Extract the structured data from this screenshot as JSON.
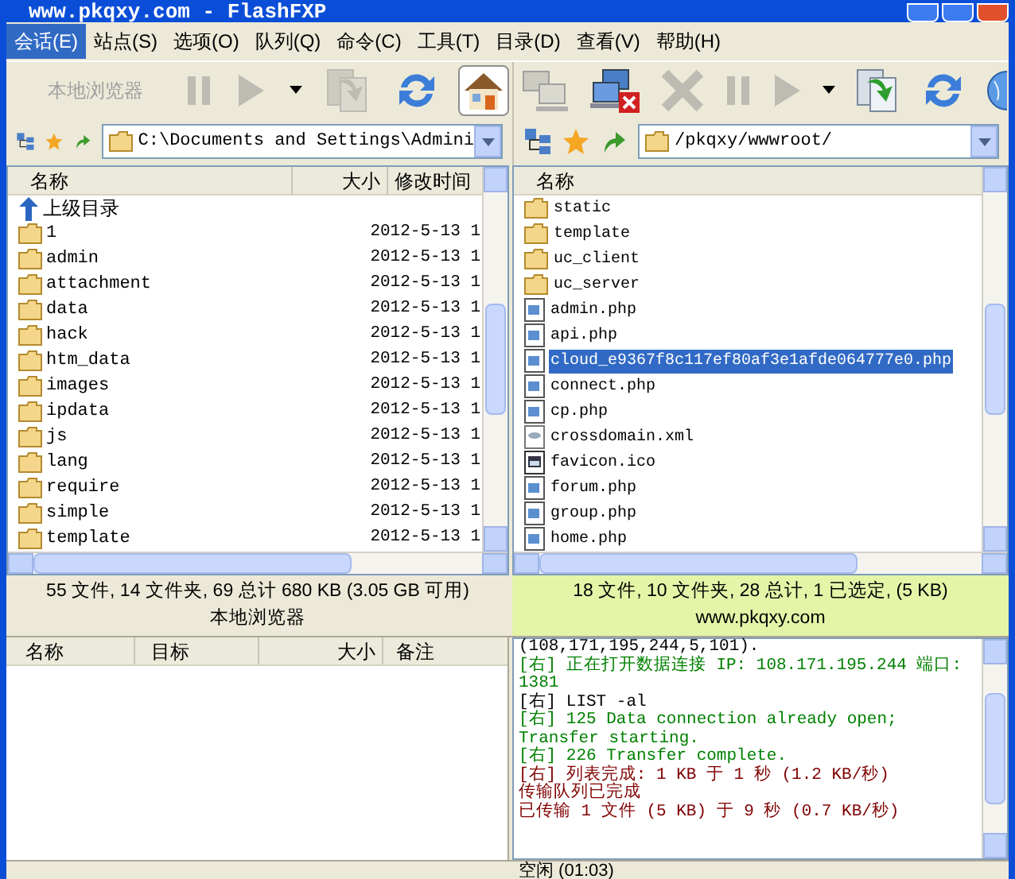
{
  "window": {
    "title": "www.pkqxy.com - FlashFXP"
  },
  "menu": [
    {
      "label": "会话(E)",
      "selected": true
    },
    {
      "label": "站点(S)",
      "selected": false
    },
    {
      "label": "选项(O)",
      "selected": false
    },
    {
      "label": "队列(Q)",
      "selected": false
    },
    {
      "label": "命令(C)",
      "selected": false
    },
    {
      "label": "工具(T)",
      "selected": false
    },
    {
      "label": "目录(D)",
      "selected": false
    },
    {
      "label": "查看(V)",
      "selected": false
    },
    {
      "label": "帮助(H)",
      "selected": false
    }
  ],
  "left_pane": {
    "toolbar_label": "本地浏览器",
    "toolbar": [
      {
        "kind": "pause",
        "disabled": true,
        "pressed": false
      },
      {
        "kind": "play",
        "disabled": true,
        "pressed": false
      },
      {
        "kind": "caret",
        "disabled": false,
        "pressed": false
      },
      {
        "kind": "transfer",
        "disabled": true,
        "pressed": false
      },
      {
        "kind": "refresh",
        "disabled": false,
        "pressed": false
      },
      {
        "kind": "home",
        "disabled": false,
        "pressed": true
      }
    ],
    "path": "C:\\Documents and Settings\\Admini",
    "columns": [
      "名称",
      "大小",
      "修改时间"
    ],
    "rows": [
      {
        "kind": "parent",
        "name": "上级目录"
      },
      {
        "kind": "folder",
        "name": "1",
        "modified": "2012-5-13 1"
      },
      {
        "kind": "folder",
        "name": "admin",
        "modified": "2012-5-13 1"
      },
      {
        "kind": "folder",
        "name": "attachment",
        "modified": "2012-5-13 1"
      },
      {
        "kind": "folder",
        "name": "data",
        "modified": "2012-5-13 1"
      },
      {
        "kind": "folder",
        "name": "hack",
        "modified": "2012-5-13 1"
      },
      {
        "kind": "folder",
        "name": "htm_data",
        "modified": "2012-5-13 1"
      },
      {
        "kind": "folder",
        "name": "images",
        "modified": "2012-5-13 1"
      },
      {
        "kind": "folder",
        "name": "ipdata",
        "modified": "2012-5-13 1"
      },
      {
        "kind": "folder",
        "name": "js",
        "modified": "2012-5-13 1"
      },
      {
        "kind": "folder",
        "name": "lang",
        "modified": "2012-5-13 1"
      },
      {
        "kind": "folder",
        "name": "require",
        "modified": "2012-5-13 1"
      },
      {
        "kind": "folder",
        "name": "simple",
        "modified": "2012-5-13 1"
      },
      {
        "kind": "folder",
        "name": "template",
        "modified": "2012-5-13 1"
      }
    ],
    "status": "55 文件, 14 文件夹, 69 总计 680 KB (3.05 GB 可用)",
    "caption": "本地浏览器"
  },
  "right_pane": {
    "toolbar": [
      {
        "kind": "connect",
        "disabled": true
      },
      {
        "kind": "disconnect",
        "disabled": false
      },
      {
        "kind": "abort",
        "disabled": true
      },
      {
        "kind": "pause",
        "disabled": true
      },
      {
        "kind": "play",
        "disabled": true
      },
      {
        "kind": "caret",
        "disabled": false
      },
      {
        "kind": "transfer",
        "disabled": false
      },
      {
        "kind": "refresh",
        "disabled": false
      },
      {
        "kind": "globe",
        "disabled": false
      }
    ],
    "path": "/pkqxy/wwwroot/",
    "columns": [
      "名称"
    ],
    "rows": [
      {
        "kind": "folder",
        "name": "static",
        "selected": false
      },
      {
        "kind": "folder",
        "name": "template",
        "selected": false
      },
      {
        "kind": "folder",
        "name": "uc_client",
        "selected": false
      },
      {
        "kind": "folder",
        "name": "uc_server",
        "selected": false
      },
      {
        "kind": "script",
        "name": "admin.php",
        "selected": false
      },
      {
        "kind": "script",
        "name": "api.php",
        "selected": false
      },
      {
        "kind": "script",
        "name": "cloud_e9367f8c117ef80af3e1afde064777e0.php",
        "selected": true
      },
      {
        "kind": "script",
        "name": "connect.php",
        "selected": false
      },
      {
        "kind": "script",
        "name": "cp.php",
        "selected": false
      },
      {
        "kind": "xml",
        "name": "crossdomain.xml",
        "selected": false
      },
      {
        "kind": "image",
        "name": "favicon.ico",
        "selected": false
      },
      {
        "kind": "script",
        "name": "forum.php",
        "selected": false
      },
      {
        "kind": "script",
        "name": "group.php",
        "selected": false
      },
      {
        "kind": "script",
        "name": "home.php",
        "selected": false
      }
    ],
    "status": "18 文件, 10 文件夹, 28 总计, 1 已选定, (5 KB)",
    "caption": "www.pkqxy.com"
  },
  "queue": {
    "columns": [
      "名称",
      "目标",
      "大小",
      "备注"
    ]
  },
  "log": [
    {
      "kind": "command",
      "text": "(108,171,195,244,5,101)."
    },
    {
      "kind": "server",
      "text": "[右] 正在打开数据连接 IP: 108.171.195.244 端口: 1381"
    },
    {
      "kind": "command",
      "text": "[右] LIST -al"
    },
    {
      "kind": "server",
      "text": "[右] 125 Data connection already open; Transfer starting."
    },
    {
      "kind": "server",
      "text": "[右] 226 Transfer complete."
    },
    {
      "kind": "status",
      "text": "[右] 列表完成: 1 KB 于 1 秒 (1.2 KB/秒)"
    },
    {
      "kind": "status",
      "text": "传输队列已完成"
    },
    {
      "kind": "status",
      "text": "已传输 1 文件 (5 KB) 于 9 秒 (0.7 KB/秒)"
    }
  ],
  "status_bar": "空闲 (01:03)"
}
